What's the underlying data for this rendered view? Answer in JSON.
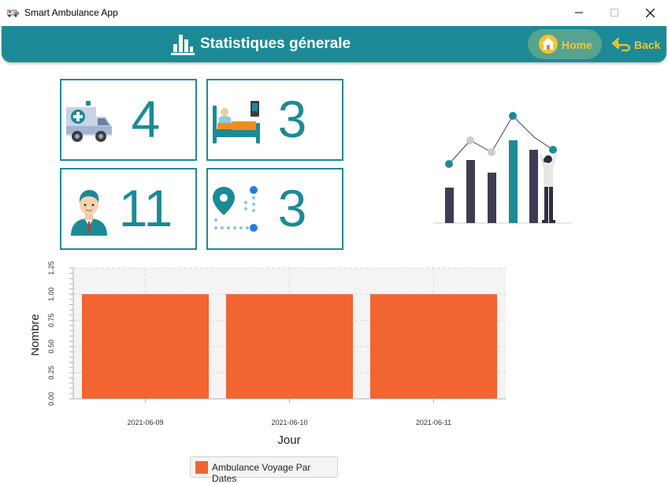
{
  "window": {
    "title": "Smart Ambulance App"
  },
  "header": {
    "title": "Statistiques génerale",
    "home_label": "Home",
    "back_label": "Back",
    "accent_color": "#1c8a96",
    "button_text_color": "#f4c430"
  },
  "cards": {
    "ambulances": {
      "value": "4",
      "icon": "ambulance-icon"
    },
    "patients": {
      "value": "3",
      "icon": "hospital-bed-icon"
    },
    "staff": {
      "value": "11",
      "icon": "doctor-icon"
    },
    "trips": {
      "value": "3",
      "icon": "route-pin-icon"
    }
  },
  "chart_data": {
    "type": "bar",
    "categories": [
      "2021-06-09",
      "2021-06-10",
      "2021-06-11"
    ],
    "series": [
      {
        "name": "Ambulance Voyage Par Dates",
        "values": [
          1,
          1,
          1
        ]
      }
    ],
    "xlabel": "Jour",
    "ylabel": "Nombre",
    "ylim": [
      0,
      1.25
    ],
    "yticks": [
      "0.00",
      "0.25",
      "0.50",
      "0.75",
      "1.00",
      "1.25"
    ],
    "grid": true,
    "legend": "bottom",
    "bar_color": "#f26430"
  }
}
